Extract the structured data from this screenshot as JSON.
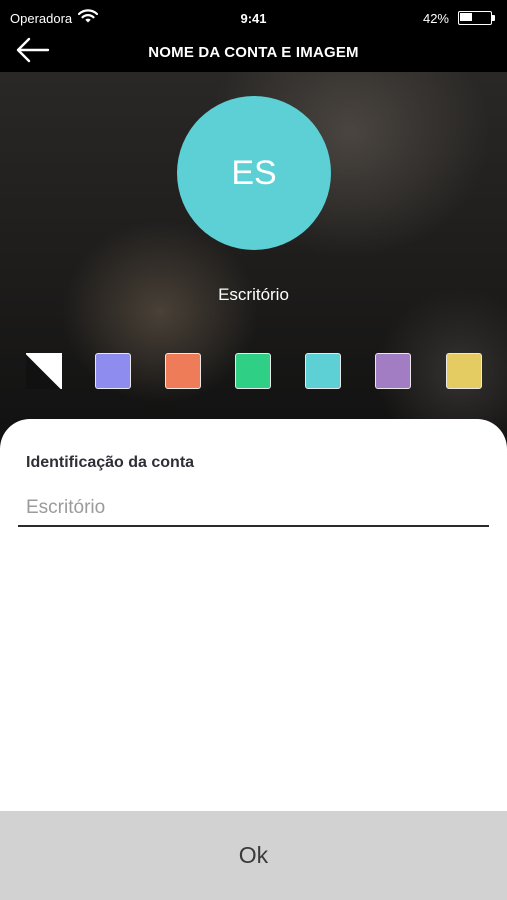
{
  "status_bar": {
    "carrier": "Operadora",
    "time": "9:41",
    "battery_percent": "42%",
    "battery_level": 0.42
  },
  "nav": {
    "title": "NOME DA CONTA E IMAGEM",
    "back_icon": "arrow-left-icon"
  },
  "avatar": {
    "initials": "ES",
    "color": "#5dd0d5"
  },
  "account": {
    "name": "Escritório"
  },
  "colors": [
    {
      "name": "none",
      "hex": "#ffffff"
    },
    {
      "name": "blue",
      "hex": "#8f8cf0"
    },
    {
      "name": "orange",
      "hex": "#ee7c58"
    },
    {
      "name": "green",
      "hex": "#2fcf86"
    },
    {
      "name": "cyan",
      "hex": "#5dd0d5"
    },
    {
      "name": "purple",
      "hex": "#a27dc4"
    },
    {
      "name": "yellow",
      "hex": "#e4cc62"
    }
  ],
  "form": {
    "label": "Identificação da conta",
    "placeholder": "Escritório",
    "value": ""
  },
  "ok_button": {
    "label": "Ok"
  }
}
